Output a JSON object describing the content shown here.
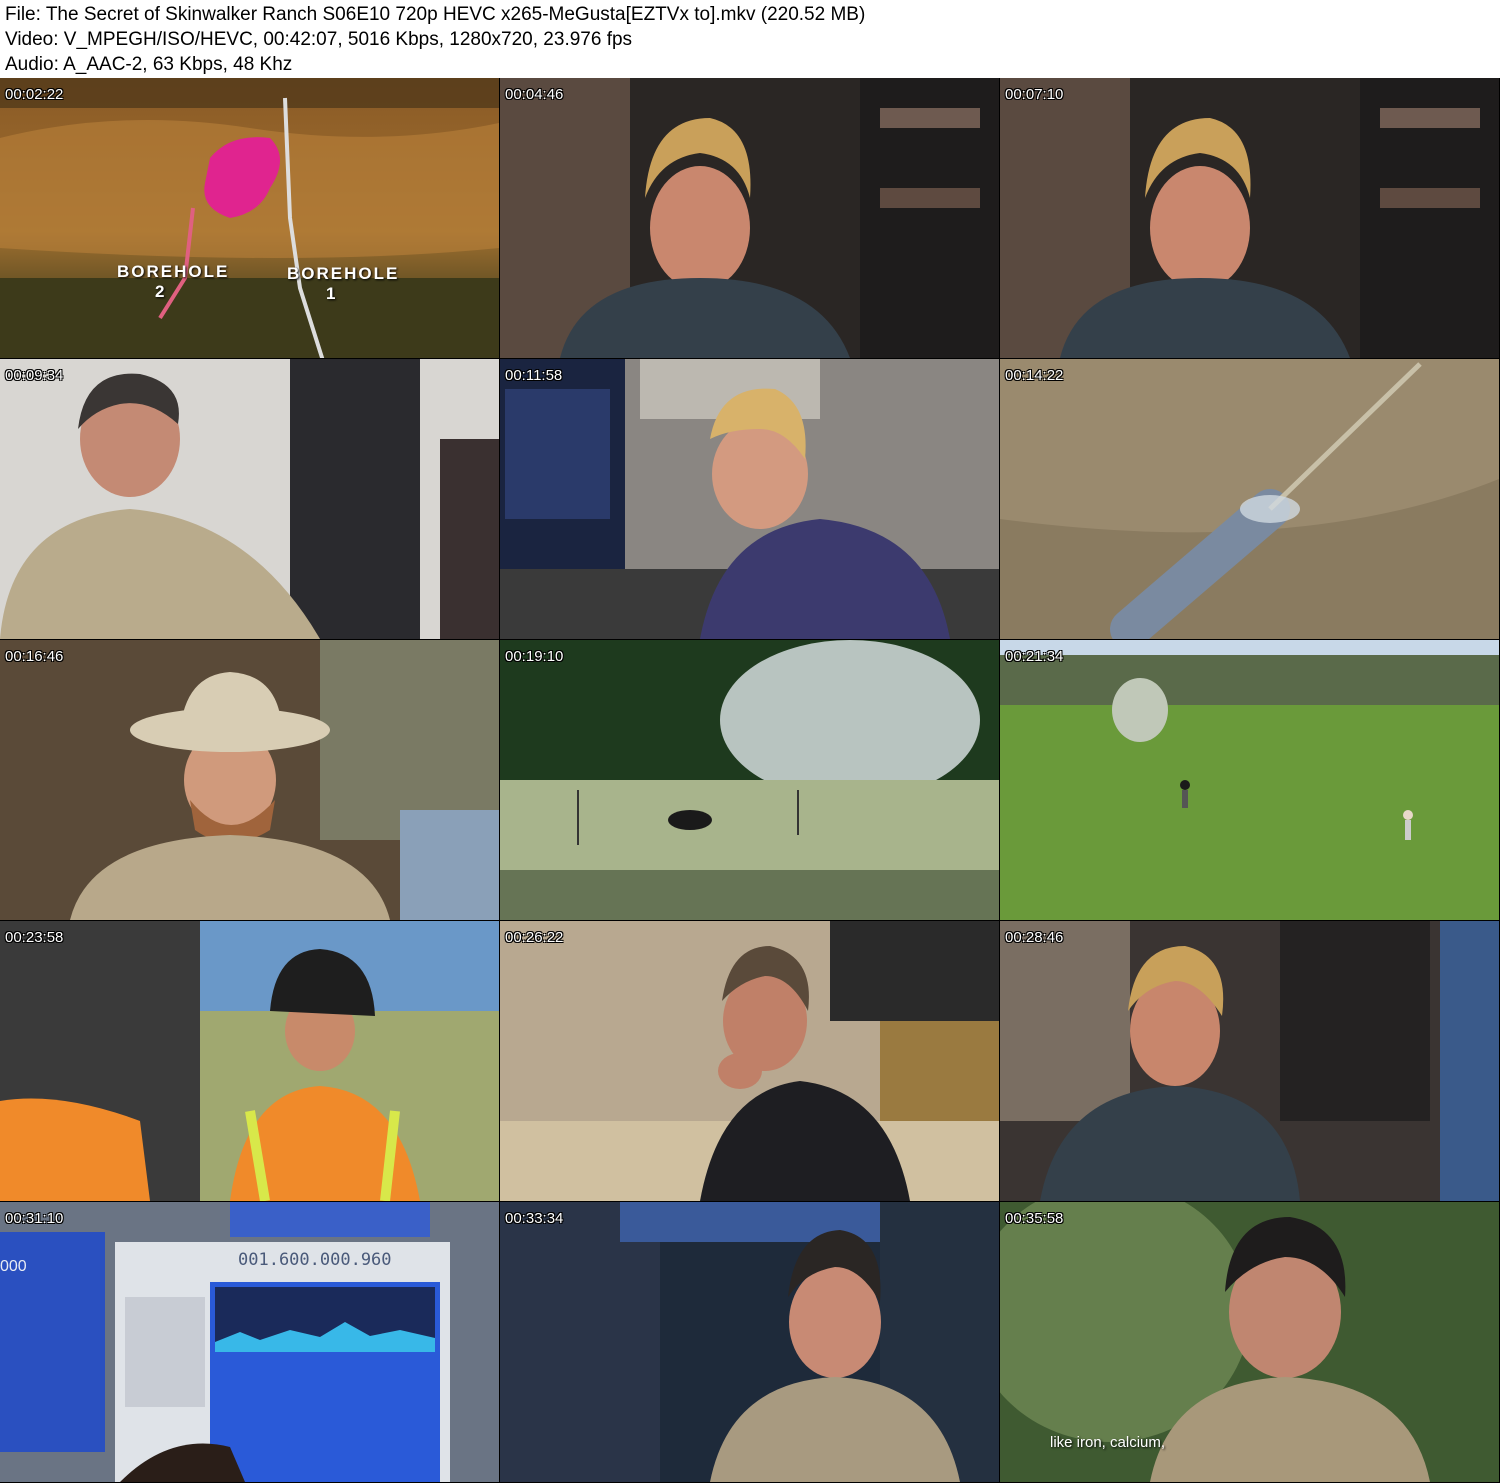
{
  "header": {
    "file_line": "File: The Secret of Skinwalker Ranch S06E10 720p HEVC x265-MeGusta[EZTVx to].mkv (220.52 MB)",
    "video_line": "Video: V_MPEGH/ISO/HEVC, 00:42:07, 5016 Kbps, 1280x720, 23.976 fps",
    "audio_line": "Audio: A_AAC-2, 63 Kbps, 48 Khz"
  },
  "thumbnails": [
    {
      "timestamp": "00:02:22",
      "label_a": "BOREHOLE",
      "label_a_num": "2",
      "label_b": "BOREHOLE",
      "label_b_num": "1"
    },
    {
      "timestamp": "00:04:46"
    },
    {
      "timestamp": "00:07:10"
    },
    {
      "timestamp": "00:09:34"
    },
    {
      "timestamp": "00:11:58"
    },
    {
      "timestamp": "00:14:22"
    },
    {
      "timestamp": "00:16:46"
    },
    {
      "timestamp": "00:19:10"
    },
    {
      "timestamp": "00:21:34"
    },
    {
      "timestamp": "00:23:58"
    },
    {
      "timestamp": "00:26:22"
    },
    {
      "timestamp": "00:28:46"
    },
    {
      "timestamp": "00:31:10",
      "freq_readout": "001.600.000.960",
      "freq_left": "000"
    },
    {
      "timestamp": "00:33:34"
    },
    {
      "timestamp": "00:35:58",
      "subtitle": "like iron, calcium,"
    }
  ]
}
